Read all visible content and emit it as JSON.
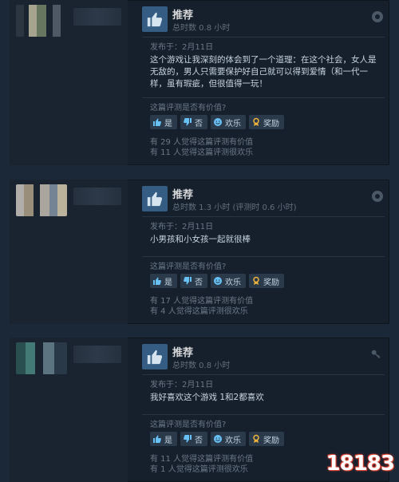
{
  "reviews": [
    {
      "recommendation": "推荐",
      "hours": "总时数 0.8 小时",
      "posted": "发布于：2月11日",
      "content": "这个游戏让我深刻的体会到了一个道理：在这个社会，女人是无敌的，男人只需要保护好自己就可以得到爱情（和一代一样，虽有瑕疵，但很值得一玩！",
      "helpful_question": "这篇评测是否有价值?",
      "buttons": [
        "是",
        "否",
        "欢乐",
        "奖励"
      ],
      "stats": [
        "有 29 人觉得这篇评测有价值",
        "有 11 人觉得这篇评测很欢乐"
      ]
    },
    {
      "recommendation": "推荐",
      "hours": "总时数 1.3 小时  (评测时 0.6 小时)",
      "posted": "发布于：2月11日",
      "content": "小男孩和小女孩一起就很棒",
      "helpful_question": "这篇评测是否有价值?",
      "buttons": [
        "是",
        "否",
        "欢乐",
        "奖励"
      ],
      "stats": [
        "有 17 人觉得这篇评测有价值",
        "有 4 人觉得这篇评测很欢乐"
      ]
    },
    {
      "recommendation": "推荐",
      "hours": "总时数 0.8 小时",
      "posted": "发布于：2月11日",
      "content": "我好喜欢这个游戏 1和2都喜欢",
      "helpful_question": "这篇评测是否有价值?",
      "buttons": [
        "是",
        "否",
        "欢乐",
        "奖励"
      ],
      "stats": [
        "有 11 人觉得这篇评测有价值",
        "有 1 人觉得这篇评测很欢乐"
      ]
    }
  ],
  "watermark": "18183",
  "icons": [
    "thumbs-up-icon",
    "thumbs-down-icon",
    "smile-icon",
    "award-icon",
    "steam-icon",
    "key-icon"
  ],
  "colors": {
    "background": "#1b2838",
    "card": "#16202d",
    "thumb_box": "#355d84",
    "button": "#2b3a4a"
  }
}
